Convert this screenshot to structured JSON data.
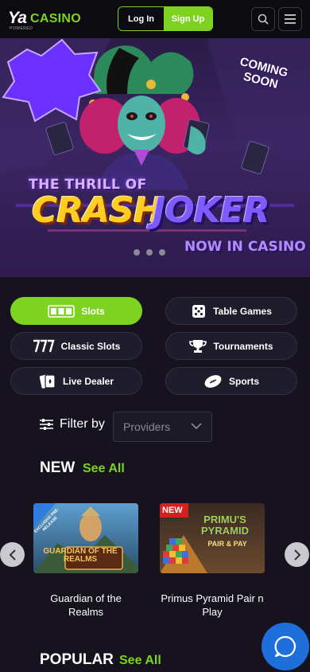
{
  "header": {
    "logo_ya": "Ya",
    "logo_tag": "POWERED",
    "logo_casino": "CASINO",
    "login_label": "Log In",
    "signup_label": "Sign Up",
    "accent": "#7ed321"
  },
  "banner": {
    "line1": "THE THRILL OF",
    "crash": "CRASH",
    "joker": "JOKER",
    "line3": "NOW IN CASINO",
    "badge": "COMING SOON",
    "slides": 3
  },
  "categories": [
    {
      "label": "Slots",
      "icon": "slot-machine-icon",
      "active": true
    },
    {
      "label": "Table Games",
      "icon": "dice-icon",
      "active": false
    },
    {
      "label": "Classic Slots",
      "icon": "sevens-icon",
      "active": false
    },
    {
      "label": "Tournaments",
      "icon": "trophy-icon",
      "active": false
    },
    {
      "label": "Live Dealer",
      "icon": "cards-icon",
      "active": false
    },
    {
      "label": "Sports",
      "icon": "football-icon",
      "active": false
    }
  ],
  "filter": {
    "label": "Filter by",
    "placeholder": "Providers"
  },
  "new_section": {
    "title": "NEW",
    "see_all": "See All",
    "games": [
      {
        "name": "Guardian of the Realms",
        "thumb_title": "GUARDIAN OF THE REALMS",
        "ribbon": "EXCLUSIVE PRE-RELEASE"
      },
      {
        "name": "Primus Pyramid Pair n Play",
        "thumb_title": "PRIMU'S PYRAMID",
        "thumb_sub": "PAIR & PAY",
        "ribbon": "NEW"
      }
    ]
  },
  "popular_section": {
    "title": "POPULAR",
    "see_all": "See All"
  }
}
